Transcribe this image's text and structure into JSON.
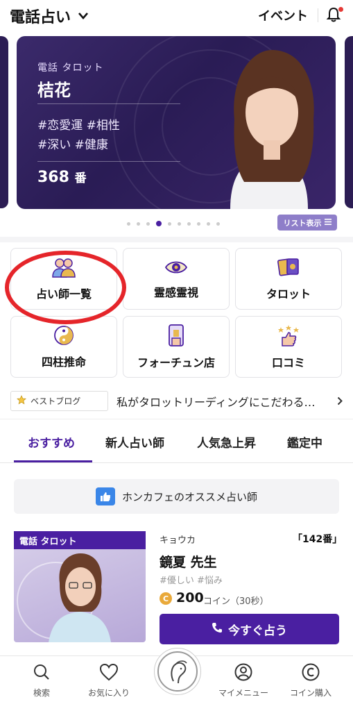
{
  "header": {
    "title": "電話占い",
    "event_label": "イベント"
  },
  "banner": {
    "tags": "電話 タロット",
    "name": "桔花",
    "genre_line1": "#恋愛運 #相性",
    "genre_line2": "#深い #健康",
    "number": "368",
    "number_suffix": "番",
    "list_button": "リスト表示"
  },
  "carousel": {
    "total": 10,
    "active_index": 3
  },
  "categories": [
    {
      "label": "占い師一覧",
      "icon": "fortune-tellers-icon"
    },
    {
      "label": "霊感霊視",
      "icon": "eye-icon"
    },
    {
      "label": "タロット",
      "icon": "tarot-cards-icon"
    },
    {
      "label": "四柱推命",
      "icon": "yin-yang-icon"
    },
    {
      "label": "フォーチュン店",
      "icon": "phone-shop-icon"
    },
    {
      "label": "口コミ",
      "icon": "thumbs-up-stars-icon"
    }
  ],
  "blog": {
    "badge": "ベストブログ",
    "text": "私がタロットリーディングにこだわる…"
  },
  "tabs": [
    {
      "label": "おすすめ",
      "active": true
    },
    {
      "label": "新人占い師",
      "active": false
    },
    {
      "label": "人気急上昇",
      "active": false
    },
    {
      "label": "鑑定中",
      "active": false
    }
  ],
  "recommend_bar": {
    "text": "ホンカフェのオススメ占い師"
  },
  "card": {
    "label": "電話 タロット",
    "kana": "キョウカ",
    "number": "「142番」",
    "name": "鏡夏 先生",
    "tags": "#優しい #悩み",
    "coin_value": "200",
    "coin_unit": "コイン（30秒）",
    "cta": "今すぐ占う"
  },
  "bottom_nav": [
    {
      "label": "検索",
      "icon": "search-icon"
    },
    {
      "label": "お気に入り",
      "icon": "heart-icon"
    },
    {
      "label": "マイメニュー",
      "icon": "user-icon"
    },
    {
      "label": "コイン購入",
      "icon": "coin-icon"
    }
  ],
  "colors": {
    "primary": "#4a1fa1",
    "highlight_circle": "#e5252a",
    "coin": "#e9a93a"
  }
}
